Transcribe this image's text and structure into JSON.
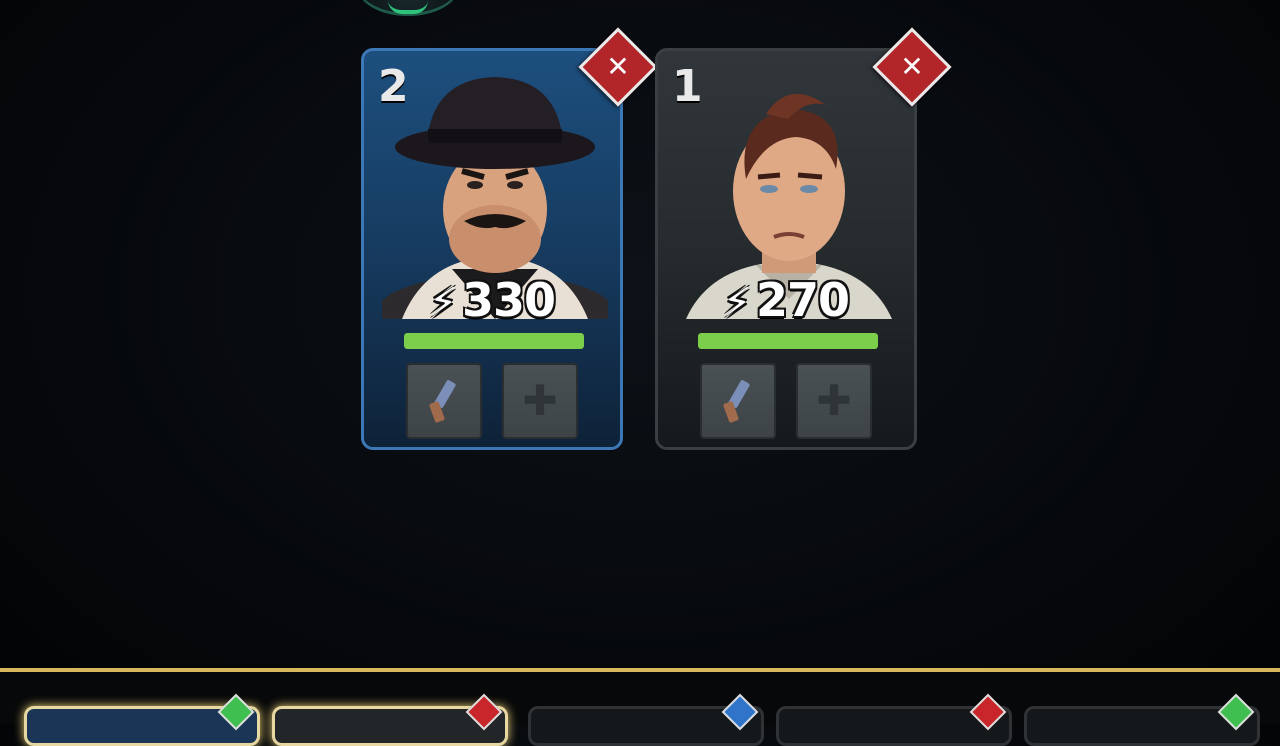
{
  "cards": [
    {
      "rank": "2",
      "power": "330",
      "health_fraction": 1.0,
      "theme": "blue",
      "remove_icon": "close-icon",
      "weapon_icon": "pistol-icon",
      "empty_slot_icon": "plus-icon"
    },
    {
      "rank": "1",
      "power": "270",
      "health_fraction": 1.0,
      "theme": "grey",
      "remove_icon": "close-icon",
      "weapon_icon": "pistol-icon",
      "empty_slot_icon": "plus-icon"
    }
  ],
  "remove_glyph": "✕",
  "bolt_glyph": "⚡",
  "plus_glyph": "✚",
  "colors": {
    "health": "#7ccf4a",
    "remove_button": "#b2262a",
    "roster_border_gold": "#d8b85c",
    "gem_green": "#3fbf4f",
    "gem_red": "#c8262b",
    "gem_blue": "#2f74c9"
  },
  "roster_gems": [
    "green",
    "red",
    "blue",
    "red",
    "green"
  ]
}
